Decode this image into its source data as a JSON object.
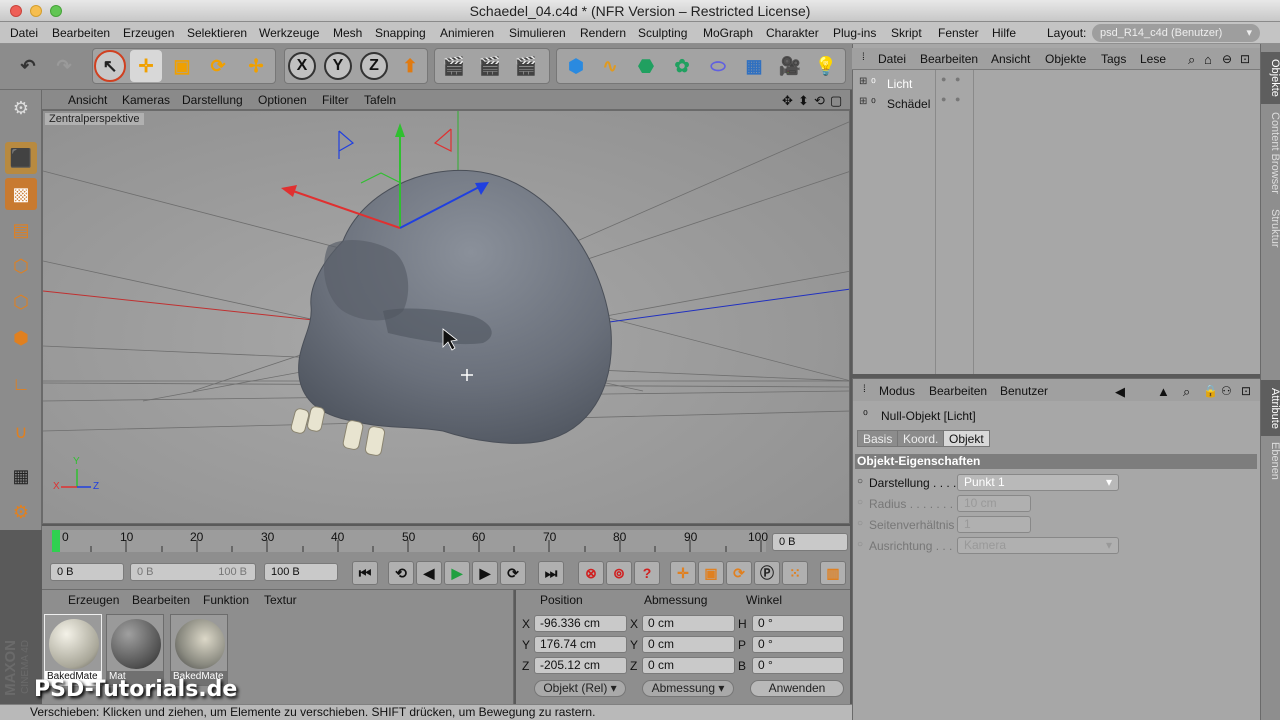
{
  "window": {
    "title": "Schaedel_04.c4d * (NFR Version – Restricted License)"
  },
  "menubar": {
    "items": [
      "Datei",
      "Bearbeiten",
      "Erzeugen",
      "Selektieren",
      "Werkzeuge",
      "Mesh",
      "Snapping",
      "Animieren",
      "Simulieren",
      "Rendern",
      "Sculpting",
      "MoGraph",
      "Charakter",
      "Plug-ins",
      "Skript",
      "Fenster",
      "Hilfe"
    ],
    "layout_label": "Layout:",
    "layout_value": "psd_R14_c4d (Benutzer)"
  },
  "toolbar": {
    "axis_x": "X",
    "axis_y": "Y",
    "axis_z": "Z"
  },
  "viewport": {
    "menu": [
      "Ansicht",
      "Kameras",
      "Darstellung",
      "Optionen",
      "Filter",
      "Tafeln"
    ],
    "camera_label": "Zentralperspektive",
    "axis_y": "Y",
    "axis_x": "X",
    "axis_z": "Z"
  },
  "timeline": {
    "ticks": [
      "0",
      "10",
      "20",
      "30",
      "40",
      "50",
      "60",
      "70",
      "80",
      "90",
      "100"
    ],
    "current_frame": "0 B"
  },
  "transport": {
    "start": "0 B",
    "range_start": "0 B",
    "range_end": "100 B",
    "end": "100 B"
  },
  "materials": {
    "menu": [
      "Erzeugen",
      "Bearbeiten",
      "Funktion",
      "Textur"
    ],
    "items": [
      {
        "name": "BakedMate"
      },
      {
        "name": "Mat"
      },
      {
        "name": "BakedMate"
      }
    ]
  },
  "coordinates": {
    "headers": [
      "Position",
      "Abmessung",
      "Winkel"
    ],
    "rows": [
      {
        "axis": "X",
        "pos": "-96.336 cm",
        "dim_axis": "X",
        "dim": "0 cm",
        "angle_axis": "H",
        "angle": "0 °"
      },
      {
        "axis": "Y",
        "pos": "176.74 cm",
        "dim_axis": "Y",
        "dim": "0 cm",
        "angle_axis": "P",
        "angle": "0 °"
      },
      {
        "axis": "Z",
        "pos": "-205.12 cm",
        "dim_axis": "Z",
        "dim": "0 cm",
        "angle_axis": "B",
        "angle": "0 °"
      }
    ],
    "mode_dropdown": "Objekt (Rel)",
    "size_dropdown": "Abmessung",
    "apply_button": "Anwenden"
  },
  "statusbar": {
    "text": "Verschieben: Klicken und ziehen, um Elemente zu verschieben. SHIFT drücken, um Bewegung zu rastern."
  },
  "object_manager": {
    "menu": [
      "Datei",
      "Bearbeiten",
      "Ansicht",
      "Objekte",
      "Tags",
      "Lese"
    ],
    "objects": [
      {
        "name": "Licht",
        "selected": true
      },
      {
        "name": "Schädel",
        "selected": false
      }
    ]
  },
  "attribute_manager": {
    "menu": [
      "Modus",
      "Bearbeiten",
      "Benutzer"
    ],
    "object_title": "Null-Objekt [Licht]",
    "tabs": [
      "Basis",
      "Koord.",
      "Objekt"
    ],
    "active_tab": "Objekt",
    "section": "Objekt-Eigenschaften",
    "properties": [
      {
        "label": "Darstellung . . . .",
        "value": "Punkt 1",
        "enabled": true
      },
      {
        "label": "Radius . . . . . . . .",
        "value": "10 cm",
        "enabled": false
      },
      {
        "label": "Seitenverhältnis",
        "value": "1",
        "enabled": false
      },
      {
        "label": "Ausrichtung . . .",
        "value": "Kamera",
        "enabled": false
      }
    ]
  },
  "right_tabs": [
    "Objekte",
    "Content Browser",
    "Struktur",
    "Attribute",
    "Ebenen"
  ],
  "branding": {
    "maxon": "MAXON",
    "cinema": "CINEMA 4D",
    "watermark": "PSD-Tutorials.de"
  },
  "colors": {
    "viewport_bg": "#999999",
    "axis_red": "#e03030",
    "axis_green": "#30c030",
    "axis_blue": "#2040e0",
    "skull": "#6b717c",
    "active_tab": "#d8d8d8",
    "section_bar": "#7d7d7d"
  }
}
